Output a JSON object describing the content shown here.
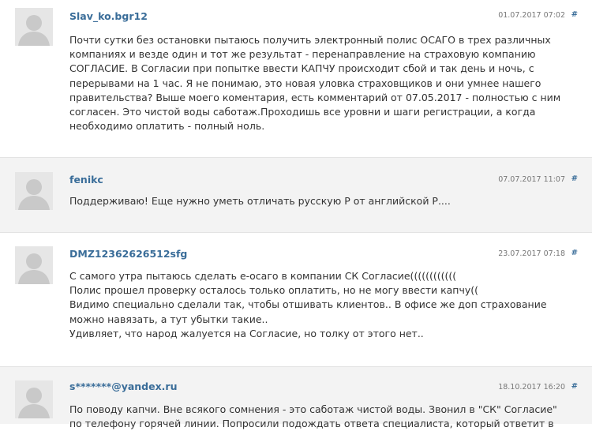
{
  "comments": [
    {
      "author": "Slav_ko.bgr12",
      "date": "01.07.2017 07:02",
      "hash": "#",
      "lines": [
        "Почти сутки без остановки пытаюсь получить электронный полис ОСАГО в трех различных",
        "компаниях и везде один и тот же результат - перенаправление на страховую компанию",
        "СОГЛАСИЕ. В Согласии при попытке ввести КАПЧУ происходит сбой и так день и ночь, с",
        "перерывами на 1 час. Я не понимаю, это новая уловка страховщиков и они умнее нашего",
        "правительства? Выше моего коментария, есть комментарий от 07.05.2017 - полностью с ним",
        "согласен. Это чистой воды саботаж.Проходишь все уровни и шаги регистрации, а когда",
        "необходимо оплатить - полный ноль."
      ]
    },
    {
      "author": "fenikc",
      "date": "07.07.2017 11:07",
      "hash": "#",
      "lines": [
        "Поддерживаю! Еще нужно уметь отличать русскую Р от английской Р...."
      ]
    },
    {
      "author": "DMZ12362626512sfg",
      "date": "23.07.2017 07:18",
      "hash": "#",
      "lines": [
        "С самого утра пытаюсь сделать е-осаго в компании СК Согласие((((((((((((",
        "Полис прошел проверку осталось только оплатить, но не могу ввести капчу((",
        "Видимо специально сделали так, чтобы отшивать клиентов.. В офисе же доп страхование",
        "можно навязать, а тут убытки такие..",
        "Удивляет, что народ жалуется на Согласие, но толку от этого нет.."
      ]
    },
    {
      "author": "s*******@yandex.ru",
      "date": "18.10.2017 16:20",
      "hash": "#",
      "lines": [
        "По поводу капчи. Вне всякого сомнения - это саботаж чистой воды. Звонил в \"СК\" Согласие\"",
        "по телефону горячей линии. Попросили подождать ответа специалиста, который ответит в"
      ]
    }
  ]
}
